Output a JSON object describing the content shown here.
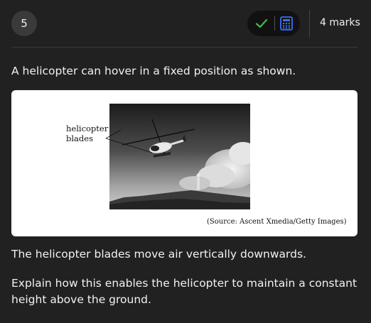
{
  "question": {
    "number": "5",
    "marks": "4 marks",
    "prompt": "A helicopter can hover in a fixed position as shown.",
    "statement": "The helicopter blades move air vertically downwards.",
    "task": "Explain how this enables the helicopter to maintain a constant height above the ground."
  },
  "toolbar": {
    "check_icon": "check-icon",
    "calculator_icon": "calculator-icon",
    "accent_green": "#3fb950",
    "accent_blue": "#3b6ff5"
  },
  "figure": {
    "label_line1": "helicopter",
    "label_line2": "blades",
    "source": "(Source: Ascent Xmedia/Getty Images)"
  }
}
